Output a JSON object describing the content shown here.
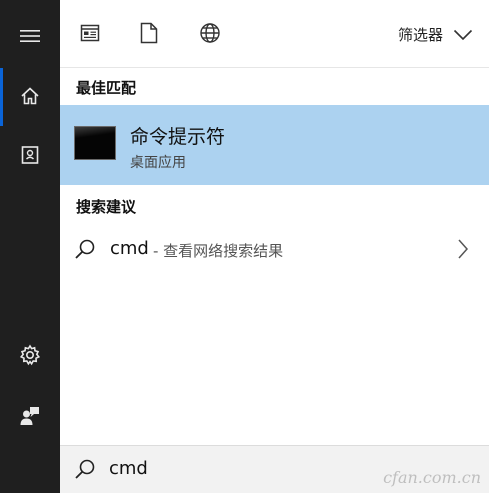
{
  "rail": {
    "items": [
      {
        "icon": "hamburger-menu-icon"
      },
      {
        "icon": "home-icon",
        "active": true
      },
      {
        "icon": "notebook-icon"
      },
      {
        "icon": "gear-icon"
      },
      {
        "icon": "user-feedback-icon"
      }
    ]
  },
  "filters": {
    "icons": [
      "app-icon",
      "document-icon",
      "globe-icon"
    ],
    "dropdown_label": "筛选器"
  },
  "best_match": {
    "heading": "最佳匹配",
    "title": "命令提示符",
    "subtitle": "桌面应用"
  },
  "suggestions": {
    "heading": "搜索建议",
    "items": [
      {
        "query": "cmd",
        "rest": "- 查看网络搜索结果"
      }
    ]
  },
  "search": {
    "value": "cmd"
  },
  "watermark": {
    "text": "cfan.com.cn"
  },
  "colors": {
    "rail": "#1f1f1f",
    "accent": "#0a64d8",
    "selection": "#acd2f0"
  }
}
